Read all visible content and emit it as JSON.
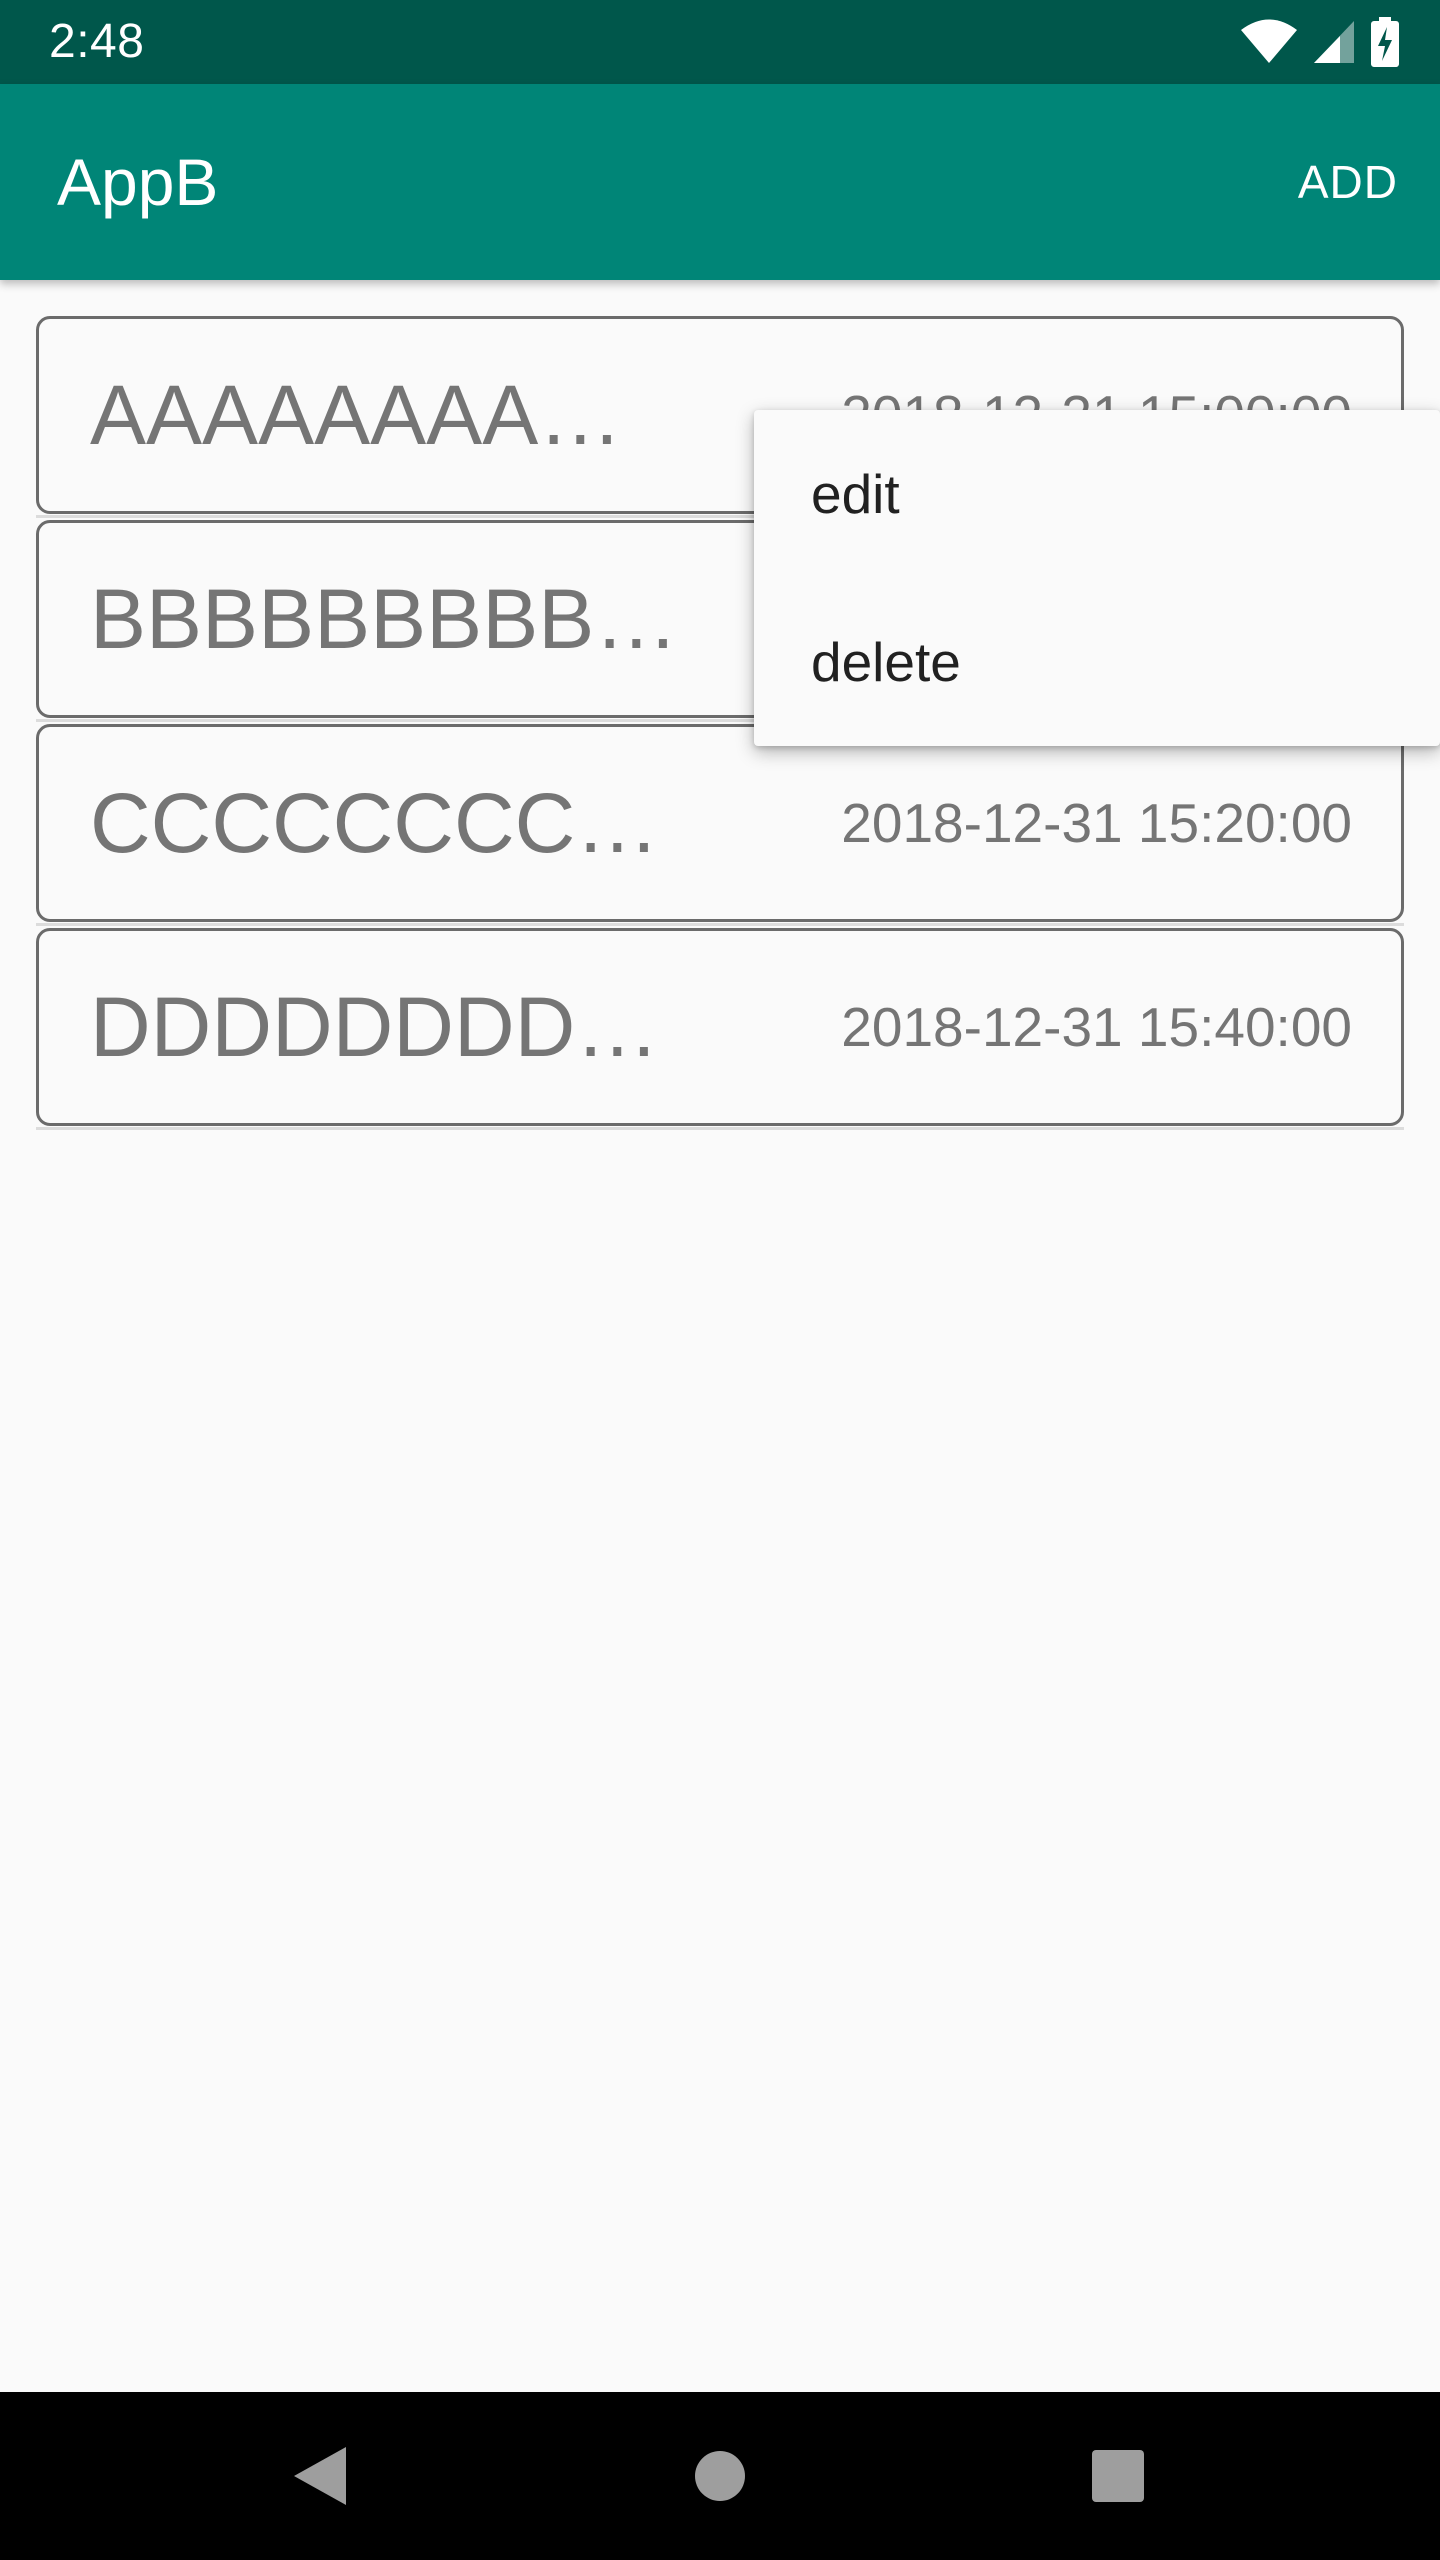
{
  "status_bar": {
    "time": "2:48",
    "icons": [
      "wifi-icon",
      "cellular-signal-icon",
      "battery-charging-icon"
    ]
  },
  "app_bar": {
    "title": "AppB",
    "action_label": "ADD"
  },
  "list": {
    "items": [
      {
        "title": "AAAAAAAA…",
        "time": "2018-12-31 15:00:00"
      },
      {
        "title": "BBBBBBBBB…",
        "time": ""
      },
      {
        "title": "CCCCCCCC…",
        "time": "2018-12-31 15:20:00"
      },
      {
        "title": "DDDDDDDD…",
        "time": "2018-12-31 15:40:00"
      }
    ]
  },
  "popup_menu": {
    "items": [
      {
        "label": "edit"
      },
      {
        "label": "delete"
      }
    ]
  },
  "nav_bar": {
    "buttons": [
      "back-icon",
      "home-icon",
      "recent-apps-icon"
    ]
  },
  "colors": {
    "status_bar": "#00574b",
    "app_bar": "#008577",
    "background": "#fafafa",
    "item_text": "#757575"
  }
}
